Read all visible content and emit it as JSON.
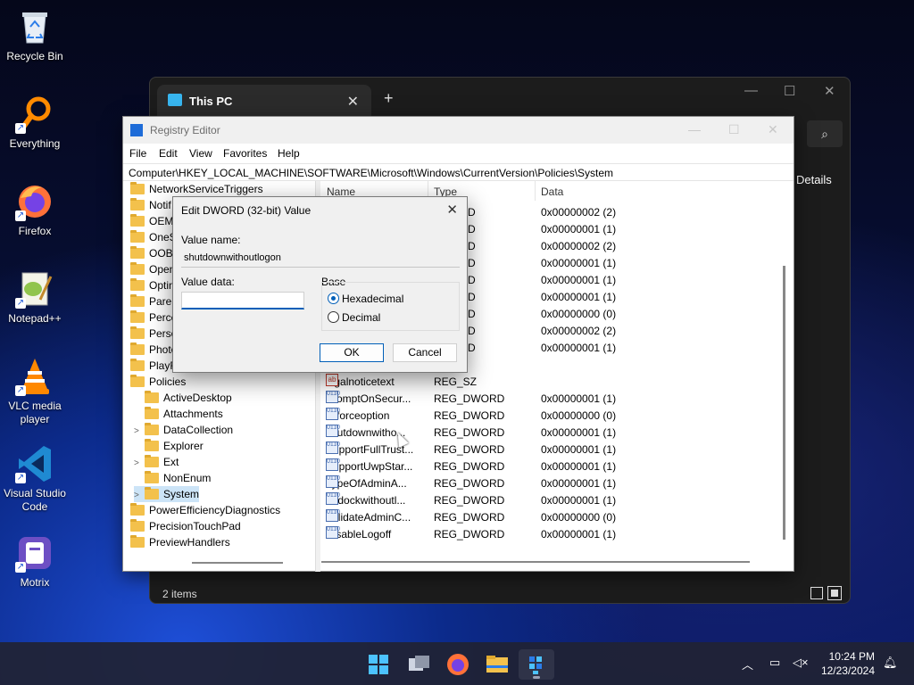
{
  "desktop": {
    "icons": [
      {
        "label": "Recycle Bin",
        "icon": "recycle-bin-icon"
      },
      {
        "label": "Everything",
        "icon": "everything-search-icon"
      },
      {
        "label": "Firefox",
        "icon": "firefox-icon"
      },
      {
        "label": "Notepad++",
        "icon": "notepadpp-icon"
      },
      {
        "label": "VLC media player",
        "icon": "vlc-icon"
      },
      {
        "label": "Visual Studio Code",
        "icon": "vscode-icon"
      },
      {
        "label": "Motrix",
        "icon": "motrix-icon"
      }
    ]
  },
  "explorer": {
    "tab_title": "This PC",
    "details_label": "Details",
    "status": "2 items"
  },
  "regedit": {
    "title": "Registry Editor",
    "menu": [
      "File",
      "Edit",
      "View",
      "Favorites",
      "Help"
    ],
    "address": "Computer\\HKEY_LOCAL_MACHINE\\SOFTWARE\\Microsoft\\Windows\\CurrentVersion\\Policies\\System",
    "tree": [
      {
        "label": "NetworkServiceTriggers",
        "indent": 0,
        "expander": ""
      },
      {
        "label": "Notif",
        "indent": 0,
        "expander": ""
      },
      {
        "label": "OEMI",
        "indent": 0,
        "expander": ""
      },
      {
        "label": "OneS",
        "indent": 0,
        "expander": ""
      },
      {
        "label": "OOBE",
        "indent": 0,
        "expander": ""
      },
      {
        "label": "Open",
        "indent": 0,
        "expander": ""
      },
      {
        "label": "Optin",
        "indent": 0,
        "expander": ""
      },
      {
        "label": "Paren",
        "indent": 0,
        "expander": ""
      },
      {
        "label": "Perce",
        "indent": 0,
        "expander": ""
      },
      {
        "label": "Perso",
        "indent": 0,
        "expander": ""
      },
      {
        "label": "Photo",
        "indent": 0,
        "expander": ""
      },
      {
        "label": "PlayR",
        "indent": 0,
        "expander": ""
      },
      {
        "label": "Policies",
        "indent": 0,
        "expander": ""
      },
      {
        "label": "ActiveDesktop",
        "indent": 1,
        "expander": ""
      },
      {
        "label": "Attachments",
        "indent": 1,
        "expander": ""
      },
      {
        "label": "DataCollection",
        "indent": 1,
        "expander": ">"
      },
      {
        "label": "Explorer",
        "indent": 1,
        "expander": ""
      },
      {
        "label": "Ext",
        "indent": 1,
        "expander": ">"
      },
      {
        "label": "NonEnum",
        "indent": 1,
        "expander": ""
      },
      {
        "label": "System",
        "indent": 1,
        "expander": ">",
        "selected": true
      },
      {
        "label": "PowerEfficiencyDiagnostics",
        "indent": 0,
        "expander": ""
      },
      {
        "label": "PrecisionTouchPad",
        "indent": 0,
        "expander": ""
      },
      {
        "label": "PreviewHandlers",
        "indent": 0,
        "expander": ""
      }
    ],
    "columns": [
      "Name",
      "Type",
      "Data"
    ],
    "values_upper": [
      {
        "type": "DWORD",
        "data": "0x00000002 (2)"
      },
      {
        "type": "DWORD",
        "data": "0x00000001 (1)"
      },
      {
        "type": "DWORD",
        "data": "0x00000002 (2)"
      },
      {
        "type": "DWORD",
        "data": "0x00000001 (1)"
      },
      {
        "type": "DWORD",
        "data": "0x00000001 (1)"
      },
      {
        "type": "DWORD",
        "data": "0x00000001 (1)"
      },
      {
        "type": "DWORD",
        "data": "0x00000000 (0)"
      },
      {
        "type": "DWORD",
        "data": "0x00000002 (2)"
      },
      {
        "type": "DWORD",
        "data": "0x00000001 (1)"
      }
    ],
    "values": [
      {
        "name": "legalnoticetext",
        "type": "REG_SZ",
        "data": "",
        "kind": "sz"
      },
      {
        "name": "PromptOnSecur...",
        "type": "REG_DWORD",
        "data": "0x00000001 (1)",
        "kind": "dw"
      },
      {
        "name": "scforceoption",
        "type": "REG_DWORD",
        "data": "0x00000000 (0)",
        "kind": "dw"
      },
      {
        "name": "shutdownwitho...",
        "type": "REG_DWORD",
        "data": "0x00000001 (1)",
        "kind": "dw"
      },
      {
        "name": "SupportFullTrust...",
        "type": "REG_DWORD",
        "data": "0x00000001 (1)",
        "kind": "dw"
      },
      {
        "name": "SupportUwpStar...",
        "type": "REG_DWORD",
        "data": "0x00000001 (1)",
        "kind": "dw"
      },
      {
        "name": "TypeOfAdminA...",
        "type": "REG_DWORD",
        "data": "0x00000001 (1)",
        "kind": "dw"
      },
      {
        "name": "undockwithoutl...",
        "type": "REG_DWORD",
        "data": "0x00000001 (1)",
        "kind": "dw"
      },
      {
        "name": "ValidateAdminC...",
        "type": "REG_DWORD",
        "data": "0x00000000 (0)",
        "kind": "dw"
      },
      {
        "name": "DisableLogoff",
        "type": "REG_DWORD",
        "data": "0x00000001 (1)",
        "kind": "dw"
      }
    ]
  },
  "dialog": {
    "title": "Edit DWORD (32-bit) Value",
    "value_name_label": "Value name:",
    "value_name": "shutdownwithoutlogon",
    "value_data_label": "Value data:",
    "value_data": "",
    "base_label": "Base",
    "base_options": [
      "Hexadecimal",
      "Decimal"
    ],
    "base_selected": "Hexadecimal",
    "ok_label": "OK",
    "cancel_label": "Cancel"
  },
  "taskbar": {
    "apps": [
      "start-icon",
      "task-view-icon",
      "firefox-icon",
      "file-explorer-icon",
      "registry-editor-icon"
    ],
    "active_app": "registry-editor-icon",
    "time": "10:24 PM",
    "date": "12/23/2024"
  },
  "colors": {
    "accent": "#005fb8",
    "folder": "#f3c14c",
    "selection": "#cce4f7"
  }
}
